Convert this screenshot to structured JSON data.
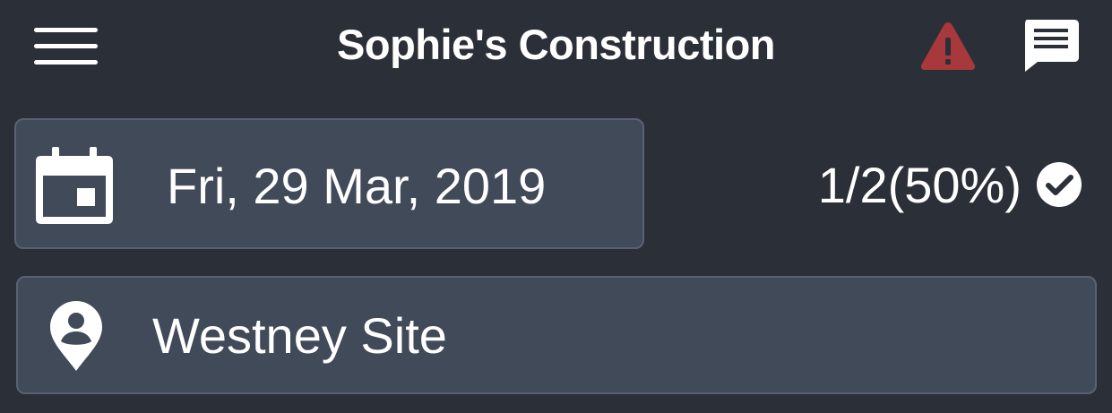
{
  "header": {
    "title": "Sophie's Construction",
    "menu_icon": "hamburger-menu-icon",
    "alert_icon": "warning-triangle-icon",
    "chat_icon": "chat-message-icon",
    "alert_color": "#b0383c"
  },
  "date_selector": {
    "icon": "calendar-icon",
    "value": "Fri, 29 Mar, 2019"
  },
  "progress": {
    "text": "1/2(50%)",
    "icon": "check-circle-icon"
  },
  "site_selector": {
    "icon": "location-pin-person-icon",
    "value": "Westney Site"
  }
}
